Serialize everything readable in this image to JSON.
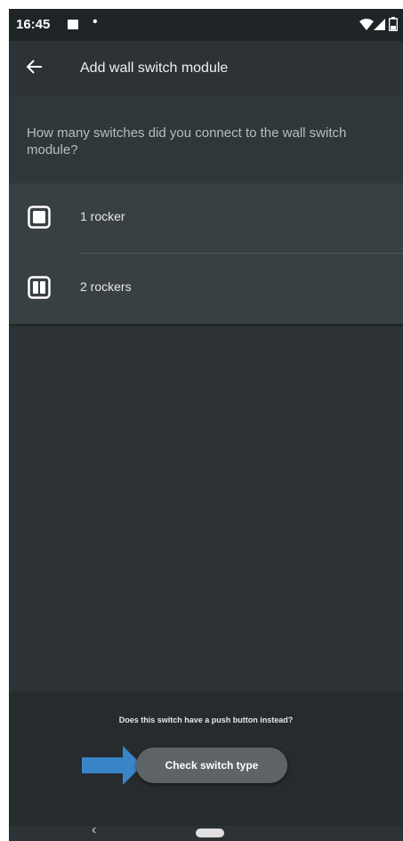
{
  "status_bar": {
    "time": "16:45",
    "dot": "•",
    "icons": [
      "image-icon",
      "wifi-icon",
      "signal-icon",
      "battery-icon"
    ]
  },
  "app_bar": {
    "title": "Add wall switch module",
    "back_icon": "arrow-left-icon"
  },
  "question": "How many switches did you connect to the wall switch module?",
  "options": [
    {
      "label": "1 rocker",
      "icon": "single-rocker-icon"
    },
    {
      "label": "2 rockers",
      "icon": "double-rocker-icon"
    }
  ],
  "bottom": {
    "question": "Does this switch have a push button instead?",
    "button_label": "Check switch type"
  },
  "nav_bar": {
    "back_glyph": "‹"
  },
  "colors": {
    "background": "#2c3235",
    "status_bar": "#1f2426",
    "options_card": "#394043",
    "bottom_panel": "#262b2d",
    "button": "#5e6466",
    "annotation_arrow": "#3a85c9"
  }
}
